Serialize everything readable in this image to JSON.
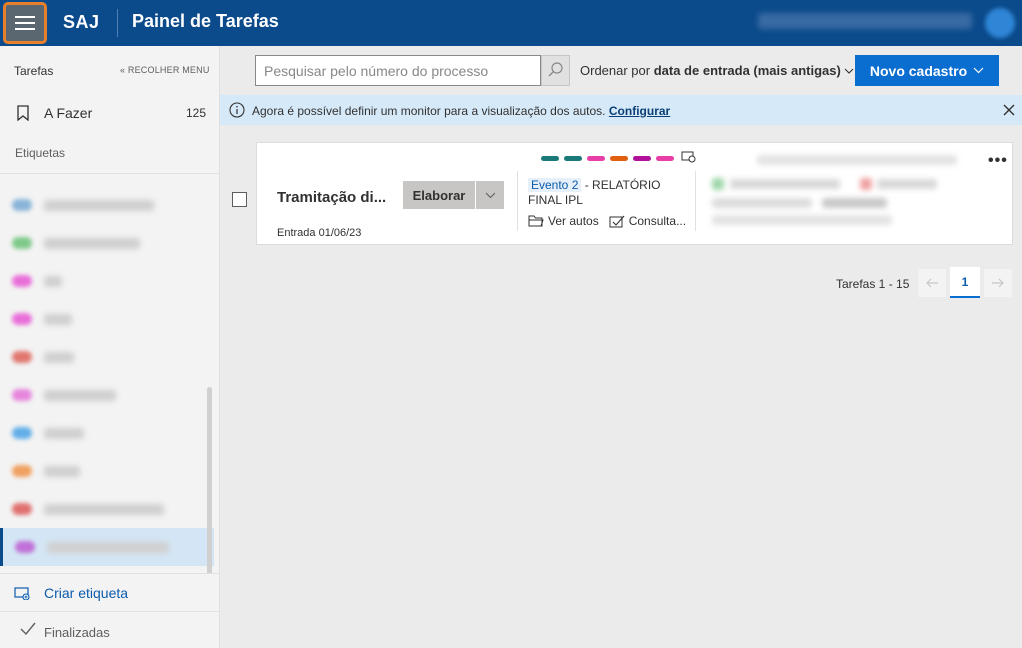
{
  "header": {
    "brand": "SAJ",
    "title": "Painel de Tarefas"
  },
  "sidebar": {
    "tasks_heading": "Tarefas",
    "collapse_label": "« RECOLHER MENU",
    "todo": {
      "label": "A Fazer",
      "count": "125"
    },
    "labels_heading": "Etiquetas",
    "label_colors": [
      "#8ab4d8",
      "#7fc98a",
      "#e86fd8",
      "#e86fd8",
      "#e0776f",
      "#e686dc",
      "#63aee8",
      "#f0a060",
      "#e07070",
      "#c070d8"
    ],
    "create_label": "Criar etiqueta",
    "finished_label": "Finalizadas"
  },
  "toolbar": {
    "search_placeholder": "Pesquisar pelo número do processo",
    "sort_prefix": "Ordenar por",
    "sort_value": "data de entrada (mais antigas)",
    "new_button": "Novo cadastro"
  },
  "banner": {
    "message": "Agora é possível definir um monitor para a visualização dos autos.",
    "link": "Configurar"
  },
  "task": {
    "title": "Tramitação di...",
    "entry": "Entrada 01/06/23",
    "action": "Elaborar",
    "tag_colors": [
      "#1a7a7a",
      "#1a7a7a",
      "#e83ea8",
      "#e06010",
      "#b0109a",
      "#e83ea8"
    ],
    "event_badge": "Evento 2",
    "event_text": "- RELATÓRIO FINAL IPL",
    "view_records": "Ver autos",
    "consult": "Consulta..."
  },
  "pagination": {
    "range_text": "Tarefas 1 - 15",
    "current_page": "1"
  },
  "colors": {
    "topbar": "#0b4a8b",
    "accent": "#0a6ed1",
    "banner": "#d6e9f8"
  }
}
